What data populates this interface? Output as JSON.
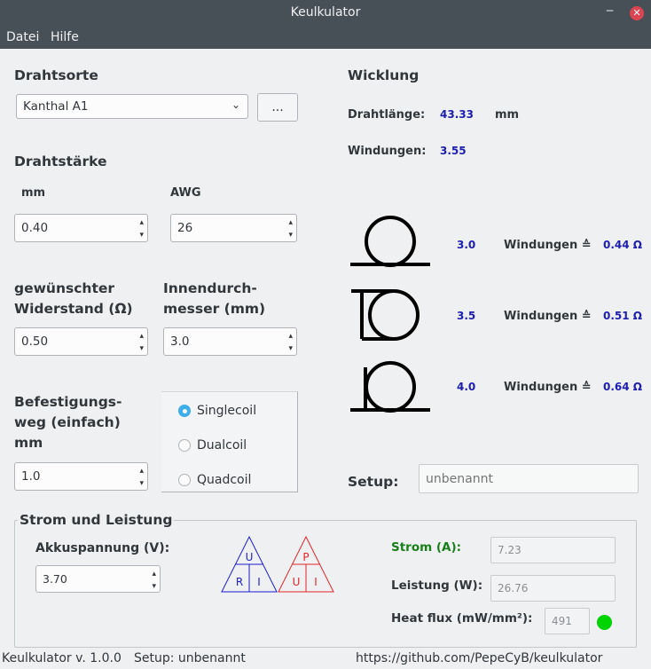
{
  "window": {
    "title": "Keulkulator"
  },
  "menu": {
    "file": "Datei",
    "help": "Hilfe"
  },
  "wire": {
    "heading": "Drahtsorte",
    "selected": "Kanthal A1",
    "more_button": "..."
  },
  "gauge": {
    "heading": "Drahtstärke",
    "mm_label": "mm",
    "mm_value": "0.40",
    "awg_label": "AWG",
    "awg_value": "26"
  },
  "resistance": {
    "label_line1": "gewünschter",
    "label_line2": "Widerstand (Ω)",
    "value": "0.50"
  },
  "inner_diameter": {
    "label_line1": "Innendurch-",
    "label_line2": "messer (mm)",
    "value": "3.0"
  },
  "leg": {
    "label_line1": "Befestigungs-",
    "label_line2": "weg (einfach)",
    "label_line3": "mm",
    "value": "1.0"
  },
  "coil_type": {
    "options": [
      "Singlecoil",
      "Dualcoil",
      "Quadcoil"
    ],
    "selected": "Singlecoil"
  },
  "winding": {
    "heading": "Wicklung",
    "length_label": "Drahtlänge:",
    "length_value": "43.33",
    "length_unit": "mm",
    "turns_label": "Windungen:",
    "turns_value": "3.55",
    "rows": [
      {
        "turns": "3.0",
        "label": "Windungen ≙",
        "ohm": "0.44 Ω",
        "icon": "coil-leads-bottom-icon"
      },
      {
        "turns": "3.5",
        "label": "Windungen ≙",
        "ohm": "0.51 Ω",
        "icon": "coil-leads-opposite-icon"
      },
      {
        "turns": "4.0",
        "label": "Windungen ≙",
        "ohm": "0.64 Ω",
        "icon": "coil-leads-bottom-icon"
      }
    ]
  },
  "setup": {
    "label": "Setup:",
    "placeholder": "unbenannt"
  },
  "power": {
    "heading": "Strom und Leistung",
    "battery_label": "Akkuspannung (V):",
    "battery_value": "3.70",
    "uri_triangle": {
      "top": "U",
      "left": "R",
      "right": "I",
      "color": "#1d1dd1"
    },
    "pui_triangle": {
      "top": "P",
      "left": "U",
      "right": "I",
      "color": "#e0242c"
    },
    "current_label": "Strom (A):",
    "current_value": "7.23",
    "current_color": "#1a7f1a",
    "power_label": "Leistung (W):",
    "power_value": "26.76",
    "heatflux_label": "Heat flux (mW/mm²):",
    "heatflux_value": "491",
    "status_color": "#00d400"
  },
  "status": {
    "version": "Keulkulator v. 1.0.0",
    "setup": "Setup: unbenannt",
    "url": "https://github.com/PepeCyB/keulkulator"
  }
}
